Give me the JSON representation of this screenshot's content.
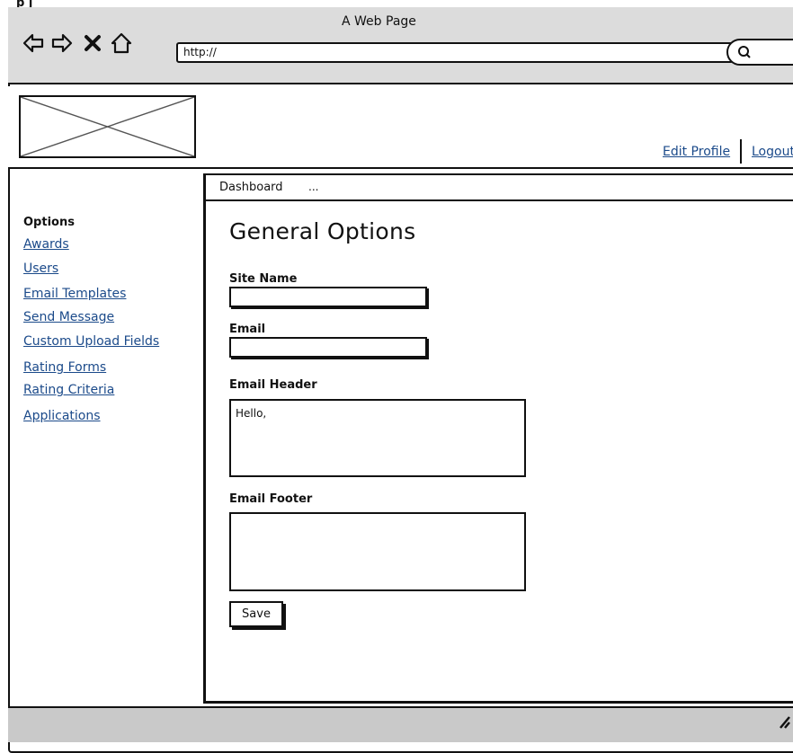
{
  "browser": {
    "window_title": "A Web Page",
    "url": "http://",
    "nav_icons": [
      "back-arrow-icon",
      "forward-arrow-icon",
      "close-x-icon",
      "home-icon"
    ],
    "search_icon": "search-icon",
    "top_clipped_text": "p ȷ"
  },
  "header": {
    "logo": "image-placeholder",
    "links": [
      "Edit Profile",
      "Logout"
    ]
  },
  "sidebar": {
    "heading": "Options",
    "items": [
      {
        "label": "Awards"
      },
      {
        "label": "Users"
      },
      {
        "label": "Email Templates"
      },
      {
        "label": "Send Message"
      },
      {
        "label": "Custom Upload Fields"
      },
      {
        "label": "Rating Forms"
      },
      {
        "label": "Rating Criteria"
      },
      {
        "label": "Applications"
      }
    ]
  },
  "breadcrumb": {
    "current": "Dashboard",
    "more": "..."
  },
  "main": {
    "title": "General Options",
    "site_name_label": "Site Name",
    "site_name_value": "",
    "email_label": "Email",
    "email_value": "",
    "email_header_label": "Email Header",
    "email_header_value": "Hello,",
    "email_footer_label": "Email Footer",
    "email_footer_value": "",
    "save_label": "Save"
  }
}
